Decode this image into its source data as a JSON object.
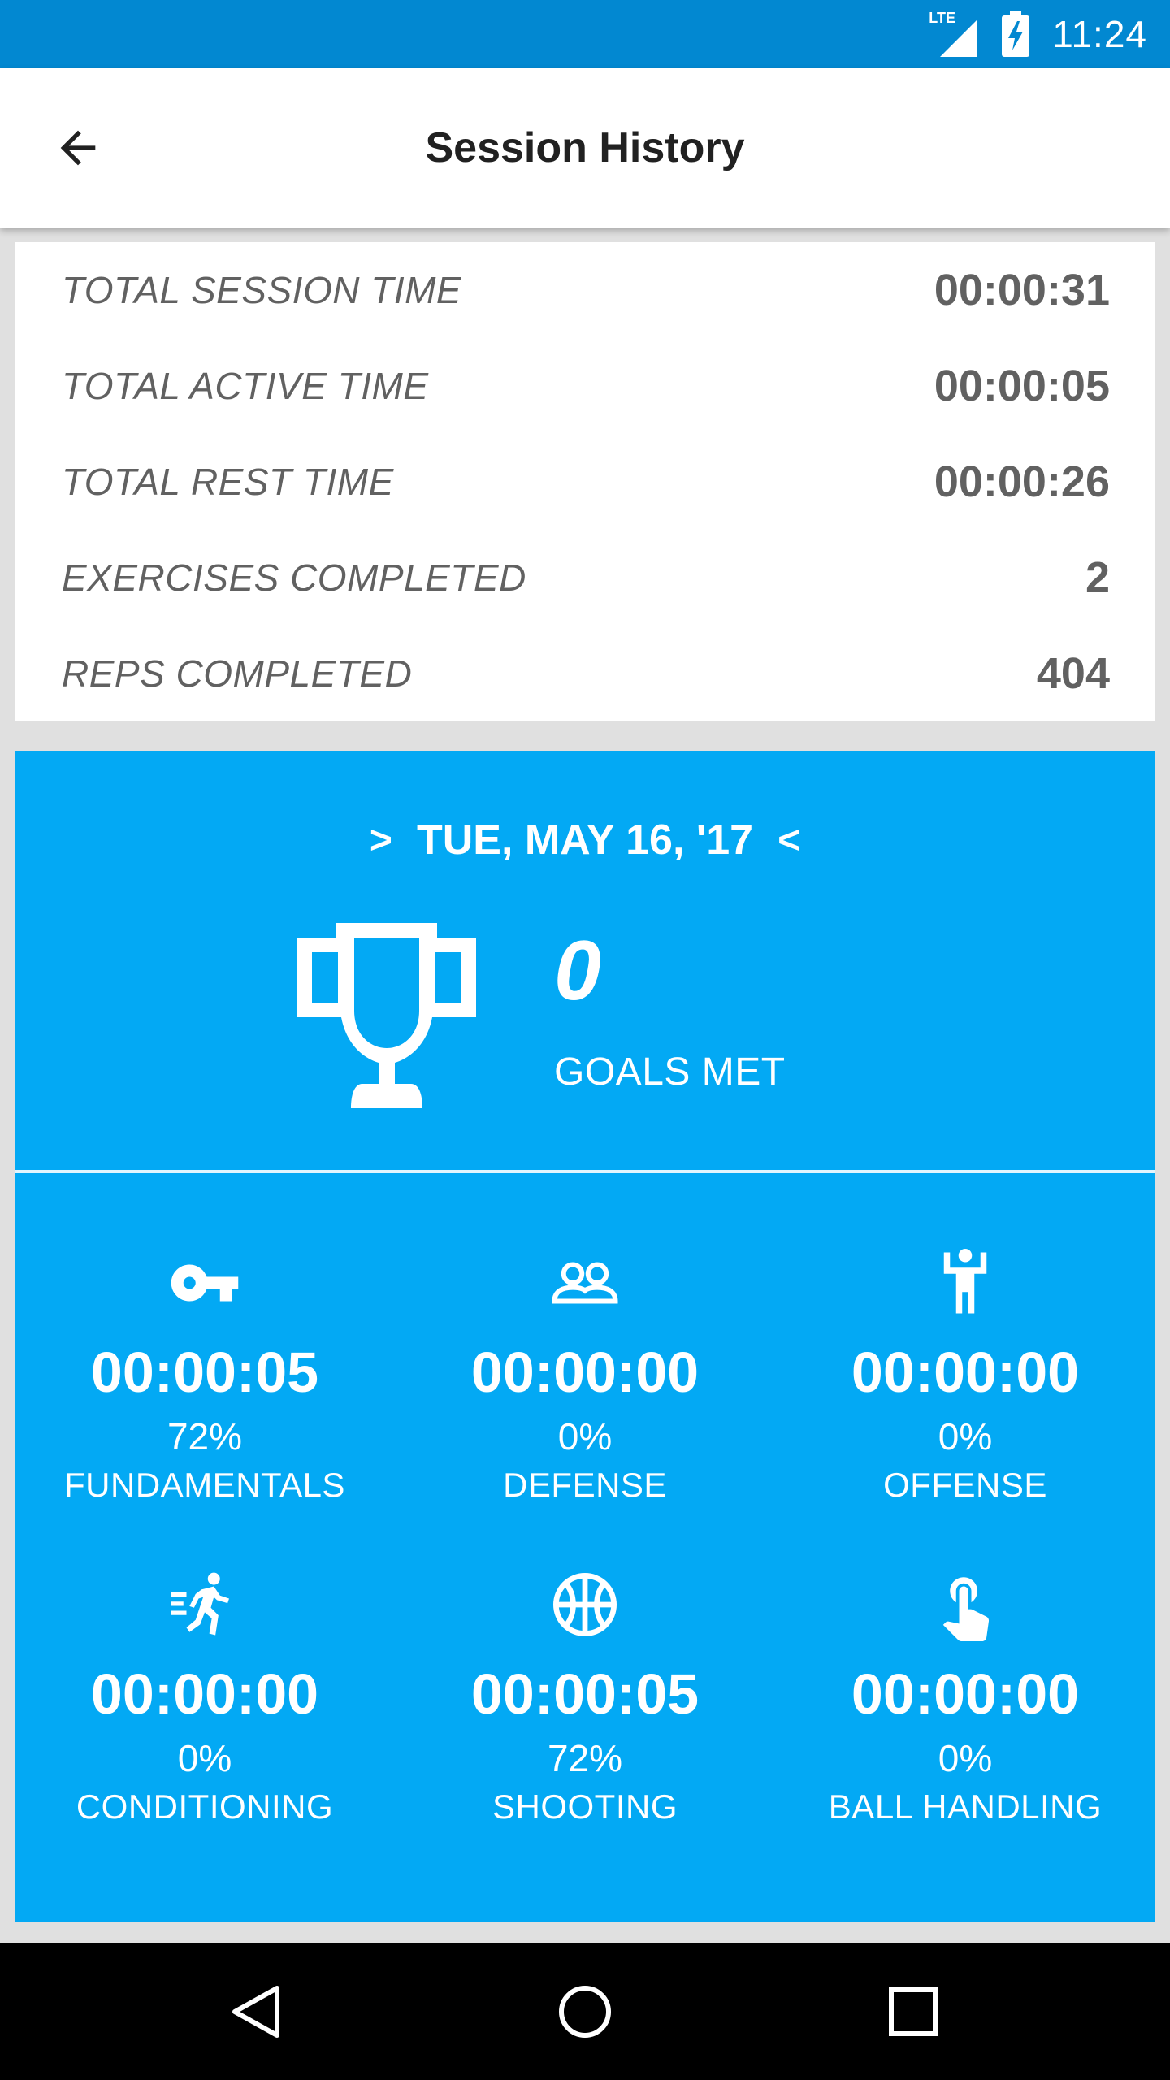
{
  "status_bar": {
    "network": "LTE",
    "time": "11:24",
    "icons": [
      "signal-icon",
      "battery-charging-icon"
    ]
  },
  "app_bar": {
    "title": "Session History",
    "back_icon": "arrow-back-icon"
  },
  "summary": [
    {
      "label": "TOTAL SESSION TIME",
      "value": "00:00:31"
    },
    {
      "label": "TOTAL ACTIVE TIME",
      "value": "00:00:05"
    },
    {
      "label": "TOTAL REST TIME",
      "value": "00:00:26"
    },
    {
      "label": "EXERCISES COMPLETED",
      "value": "2"
    },
    {
      "label": "REPS COMPLETED",
      "value": "404"
    }
  ],
  "session": {
    "prev_arrow": ">",
    "date": "TUE, MAY 16, '17",
    "next_arrow": "<",
    "goals_count": "0",
    "goals_label": "GOALS MET",
    "trophy_icon": "trophy-icon"
  },
  "categories": [
    {
      "icon": "key-icon",
      "time": "00:00:05",
      "percent": "72%",
      "name": "FUNDAMENTALS"
    },
    {
      "icon": "people-icon",
      "time": "00:00:00",
      "percent": "0%",
      "name": "DEFENSE"
    },
    {
      "icon": "player-arms-up-icon",
      "time": "00:00:00",
      "percent": "0%",
      "name": "OFFENSE"
    },
    {
      "icon": "running-icon",
      "time": "00:00:00",
      "percent": "0%",
      "name": "CONDITIONING"
    },
    {
      "icon": "basketball-icon",
      "time": "00:00:05",
      "percent": "72%",
      "name": "SHOOTING"
    },
    {
      "icon": "touch-icon",
      "time": "00:00:00",
      "percent": "0%",
      "name": "BALL HANDLING"
    }
  ],
  "colors": {
    "status_bar": "#0288d1",
    "card_blue": "#03a9f4",
    "label_grey": "#616161"
  },
  "nav": {
    "back_icon": "nav-back-icon",
    "home_icon": "nav-home-icon",
    "recents_icon": "nav-recents-icon"
  }
}
